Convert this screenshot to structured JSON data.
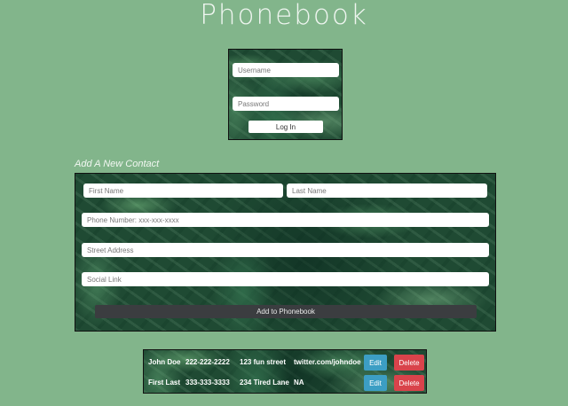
{
  "app": {
    "title": "Phonebook"
  },
  "login": {
    "username_placeholder": "Username",
    "password_placeholder": "Password",
    "login_label": "Log In"
  },
  "add_contact": {
    "heading": "Add A New Contact",
    "first_name_placeholder": "First Name",
    "last_name_placeholder": "Last Name",
    "phone_placeholder": "Phone Number: xxx-xxx-xxxx",
    "address_placeholder": "Street Address",
    "social_placeholder": "Social Link",
    "submit_label": "Add to Phonebook"
  },
  "contacts": [
    {
      "name": "John Doe",
      "phone": "222-222-2222",
      "address": "123 fun street",
      "social": "twitter.com/johndoe",
      "edit_label": "Edit",
      "delete_label": "Delete"
    },
    {
      "name": "First Last",
      "phone": "333-333-3333",
      "address": "234 Tired Lane",
      "social": "NA",
      "edit_label": "Edit",
      "delete_label": "Delete"
    }
  ],
  "colors": {
    "background": "#82b58b",
    "edit_button": "#3c9ec4",
    "delete_button": "#d9434b",
    "submit_button": "#3b3d40"
  }
}
